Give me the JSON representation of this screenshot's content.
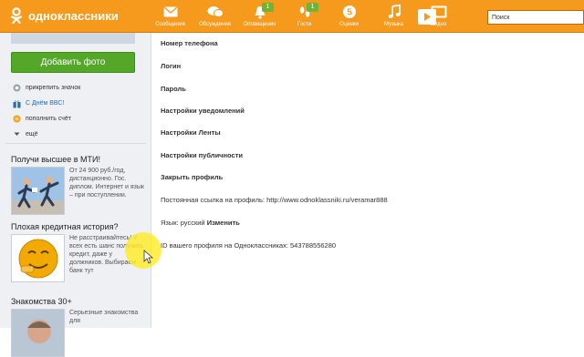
{
  "colors": {
    "topbar": "#f59a1d",
    "button_green": "#55a72a",
    "sidebar_bg": "#eef0f4",
    "badge": "#6fb436",
    "link_blue": "#2a6fb0"
  },
  "header": {
    "logo_text": "одноклассники",
    "search_placeholder": "Поиск",
    "nav": [
      {
        "label": "Сообщения",
        "icon": "envelope-icon",
        "badge": ""
      },
      {
        "label": "Обсуждения",
        "icon": "chat-bubbles-icon",
        "badge": ""
      },
      {
        "label": "Оповещения",
        "icon": "bell-icon",
        "badge": "1"
      },
      {
        "label": "Гости",
        "icon": "footprints-icon",
        "badge": "1"
      },
      {
        "label": "Оценки",
        "icon": "rating-5-icon",
        "badge": ""
      },
      {
        "label": "Музыка",
        "icon": "music-note-icon",
        "badge": ""
      },
      {
        "label": "Видео",
        "icon": "video-icon",
        "badge": ""
      }
    ]
  },
  "sidebar": {
    "add_photo_label": "Добавить фото",
    "links": [
      {
        "label": "прикрепить значок",
        "icon": "badge-icon"
      },
      {
        "label": "С Днём ВВС!",
        "icon": "gift-icon"
      },
      {
        "label": "пополнить счёт",
        "icon": "coin-icon"
      },
      {
        "label": "ещё",
        "icon": "chevron-down-icon"
      }
    ],
    "ads": [
      {
        "title": "Получи высшее в МТИ!",
        "text": "От 24 900 руб./год, дистанционно. Гос. диплом. Интернет и язык – при поступлении."
      },
      {
        "title": "Плохая кредитная история?",
        "text": "Не расстраивайтесь! У всех есть шанс получить кредит, даже у должников. Выбираем банк тут"
      },
      {
        "title": "Знакомства 30+",
        "text": "Серьезные знакомства для"
      }
    ]
  },
  "settings": {
    "items": [
      "Номер телефона",
      "Логин",
      "Пароль",
      "Настройки уведомлений",
      "Настройки Ленты",
      "Настройки публичности",
      "Закрыть профиль"
    ],
    "permalink_label": "Постоянная ссылка на профиль:",
    "permalink_url": "http://www.odnoklassniki.ru/veramar888",
    "language_label": "Язык: русский",
    "language_change": "Изменить",
    "profile_id_label": "ID вашего профиля на Одноклассниках:",
    "profile_id": "543788556280"
  }
}
